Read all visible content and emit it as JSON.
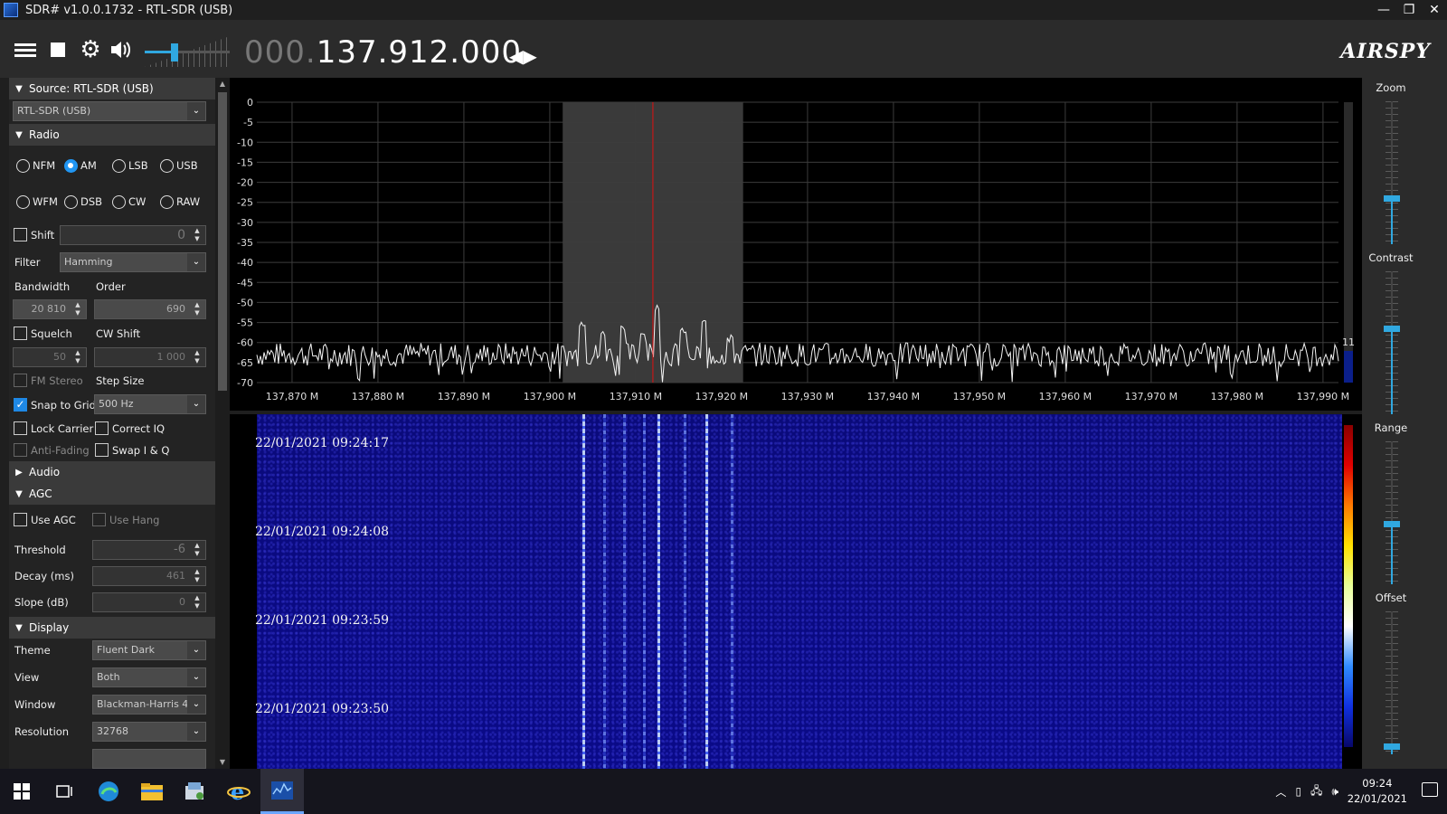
{
  "window": {
    "title": "SDR# v1.0.0.1732 - RTL-SDR (USB)",
    "minimize": "—",
    "restore": "❐",
    "close": "✕"
  },
  "toolbar": {
    "freq_dim": "000.",
    "freq_bright": "137.912.000",
    "brand": "AIRSPY",
    "volume_level": 0.33
  },
  "source": {
    "header": "Source: RTL-SDR (USB)",
    "device": "RTL-SDR (USB)"
  },
  "radio": {
    "header": "Radio",
    "modes_row1": [
      "NFM",
      "AM",
      "LSB",
      "USB"
    ],
    "modes_row2": [
      "WFM",
      "DSB",
      "CW",
      "RAW"
    ],
    "selected_mode": "AM",
    "shift_label": "Shift",
    "shift_value": "0",
    "filter_label": "Filter",
    "filter_value": "Hamming",
    "bandwidth_label": "Bandwidth",
    "bandwidth_value": "20 810",
    "order_label": "Order",
    "order_value": "690",
    "squelch_label": "Squelch",
    "squelch_value": "50",
    "cwshift_label": "CW Shift",
    "cwshift_value": "1 000",
    "fmstereo_label": "FM Stereo",
    "stepsize_label": "Step Size",
    "snap_label": "Snap to Grid",
    "step_value": "500 Hz",
    "lockcarrier_label": "Lock Carrier",
    "correctiq_label": "Correct IQ",
    "antifading_label": "Anti-Fading",
    "swapiq_label": "Swap I & Q"
  },
  "audio": {
    "header": "Audio"
  },
  "agc": {
    "header": "AGC",
    "use_agc": "Use AGC",
    "use_hang": "Use Hang",
    "threshold_label": "Threshold",
    "threshold_value": "-6",
    "decay_label": "Decay (ms)",
    "decay_value": "461",
    "slope_label": "Slope (dB)",
    "slope_value": "0"
  },
  "display": {
    "header": "Display",
    "theme_label": "Theme",
    "theme_value": "Fluent Dark",
    "view_label": "View",
    "view_value": "Both",
    "window_label": "Window",
    "window_value": "Blackman-Harris 4",
    "resolution_label": "Resolution",
    "resolution_value": "32768"
  },
  "right": {
    "zoom": "Zoom",
    "contrast": "Contrast",
    "range": "Range",
    "offset": "Offset",
    "level_readout": "11"
  },
  "chart_data": {
    "type": "line",
    "y_ticks": [
      "0",
      "-5",
      "-10",
      "-15",
      "-20",
      "-25",
      "-30",
      "-35",
      "-40",
      "-45",
      "-50",
      "-55",
      "-60",
      "-65",
      "-70"
    ],
    "ylim": [
      -70,
      0
    ],
    "x_ticks": [
      "137,870 M",
      "137,880 M",
      "137,890 M",
      "137,900 M",
      "137,910 M",
      "137,920 M",
      "137,930 M",
      "137,940 M",
      "137,950 M",
      "137,960 M",
      "137,970 M",
      "137,980 M",
      "137,990 M"
    ],
    "xlim_mhz": [
      137.8659,
      137.9918
    ],
    "tuned_mhz": 137.912,
    "filter_band_mhz": [
      137.9015,
      137.9225
    ],
    "noise_floor_db": -63,
    "peaks": [
      {
        "mhz": 137.9038,
        "db": -55
      },
      {
        "mhz": 137.9062,
        "db": -58
      },
      {
        "mhz": 137.9085,
        "db": -56
      },
      {
        "mhz": 137.9108,
        "db": -57
      },
      {
        "mhz": 137.9125,
        "db": -51
      },
      {
        "mhz": 137.9155,
        "db": -57
      },
      {
        "mhz": 137.918,
        "db": -55
      },
      {
        "mhz": 137.921,
        "db": -59
      }
    ],
    "grid": true
  },
  "waterfall": {
    "timestamps": [
      "22/01/2021 09:24:17",
      "22/01/2021 09:24:08",
      "22/01/2021 09:23:59",
      "22/01/2021 09:23:50"
    ]
  },
  "taskbar": {
    "time": "09:24",
    "date": "22/01/2021"
  }
}
